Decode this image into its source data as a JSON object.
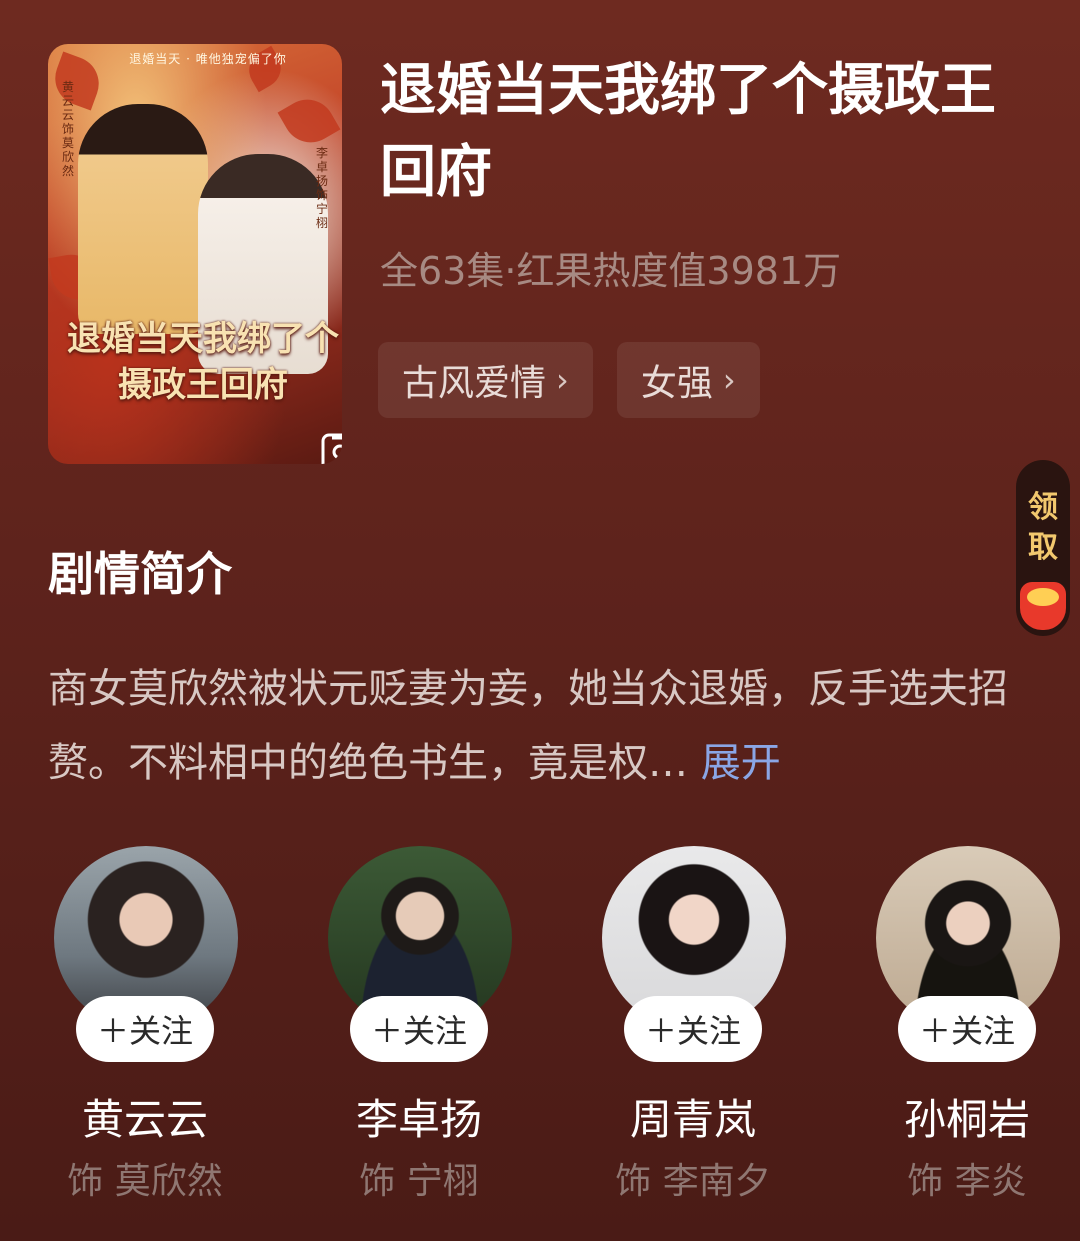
{
  "poster": {
    "tagline": "退婚当天 · 唯他独宠偏了你",
    "title": "退婚当天我绑了个摄政王回府",
    "actor_left": "黄云云饰莫欣然",
    "actor_right": "李卓扬饰宁栩"
  },
  "drama": {
    "title": "退婚当天我绑了个摄政王回府",
    "meta": "全63集·红果热度值3981万",
    "tags": [
      {
        "label": "古风爱情"
      },
      {
        "label": "女强"
      }
    ]
  },
  "reward": {
    "label_1": "领",
    "label_2": "取"
  },
  "synopsis": {
    "heading": "剧情简介",
    "text": "商女莫欣然被状元贬妻为妾，她当众退婚，反手选夫招赘。不料相中的绝色书生，竟是权…",
    "expand": "展开"
  },
  "cast": [
    {
      "name": "黄云云",
      "role": "饰 莫欣然",
      "follow": "＋关注"
    },
    {
      "name": "李卓扬",
      "role": "饰 宁栩",
      "follow": "＋关注"
    },
    {
      "name": "周青岚",
      "role": "饰 李南夕",
      "follow": "＋关注"
    },
    {
      "name": "孙桐岩",
      "role": "饰 李炎",
      "follow": "＋关注"
    }
  ]
}
